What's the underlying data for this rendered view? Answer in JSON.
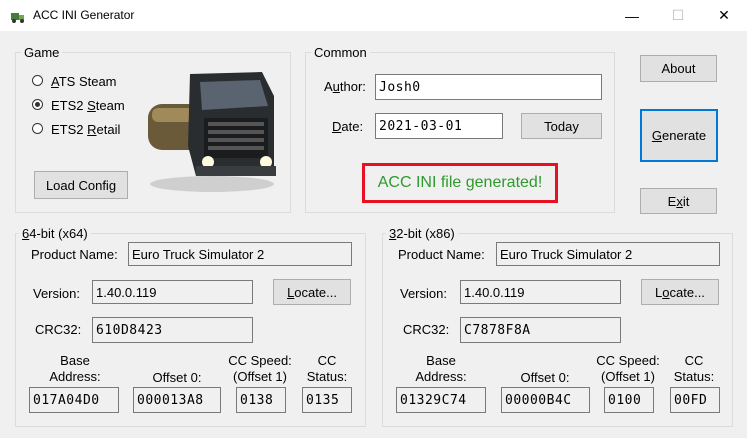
{
  "window": {
    "title": "ACC INI Generator",
    "minimize": "—",
    "maximize": "☐",
    "close": "✕"
  },
  "game": {
    "legend": "Game",
    "options": [
      {
        "label": "ATS Steam",
        "accel": "A",
        "rest": "TS Steam",
        "selected": false
      },
      {
        "label": "ETS2 Steam",
        "pre": "ETS2 ",
        "accel": "S",
        "rest": "team",
        "selected": true
      },
      {
        "label": "ETS2 Retail",
        "pre": "ETS2 ",
        "accel": "R",
        "rest": "etail",
        "selected": false
      }
    ],
    "load_button": "Load Config"
  },
  "common": {
    "legend": "Common",
    "author_label_pre": "A",
    "author_label_accel": "u",
    "author_label_rest": "thor:",
    "author_value": "Josh0",
    "date_label_pre": "",
    "date_label_accel": "D",
    "date_label_rest": "ate:",
    "date_value": "2021-03-01",
    "today_button": "Today",
    "status": "ACC INI file generated!"
  },
  "buttons": {
    "about": "About",
    "generate_accel": "G",
    "generate_rest": "enerate",
    "exit_pre": "E",
    "exit_accel": "x",
    "exit_rest": "it"
  },
  "x64": {
    "legend_accel": "6",
    "legend_rest": "4-bit (x64)",
    "product_label": "Product Name:",
    "product_value": "Euro Truck Simulator 2",
    "version_label": "Version:",
    "version_value": "1.40.0.119",
    "locate_accel": "L",
    "locate_rest": "ocate...",
    "crc_label": "CRC32:",
    "crc_value": "610D8423",
    "base_label": "Base\nAddress:",
    "base_value": "017A04D0",
    "offset_label": "Offset 0:",
    "offset_value": "000013A8",
    "ccspeed_label": "CC Speed:\n(Offset 1)",
    "ccspeed_value": "0138",
    "ccstatus_label": "CC\nStatus:",
    "ccstatus_value": "0135"
  },
  "x86": {
    "legend_accel": "3",
    "legend_rest": "2-bit (x86)",
    "product_label": "Product Name:",
    "product_value": "Euro Truck Simulator 2",
    "version_label": "Version:",
    "version_value": "1.40.0.119",
    "locate_pre": "L",
    "locate_accel": "o",
    "locate_rest": "cate...",
    "crc_label": "CRC32:",
    "crc_value": "C7878F8A",
    "base_label": "Base\nAddress:",
    "base_value": "01329C74",
    "offset_label": "Offset 0:",
    "offset_value": "00000B4C",
    "ccspeed_label": "CC Speed:\n(Offset 1)",
    "ccspeed_value": "0100",
    "ccstatus_label": "CC\nStatus:",
    "ccstatus_value": "00FD"
  },
  "colors": {
    "status_text": "#2e9a2e",
    "status_border": "#e81123",
    "focus_border": "#0078d7"
  },
  "icons": {
    "app": "truck-app-icon",
    "image": "truck-illustration"
  }
}
